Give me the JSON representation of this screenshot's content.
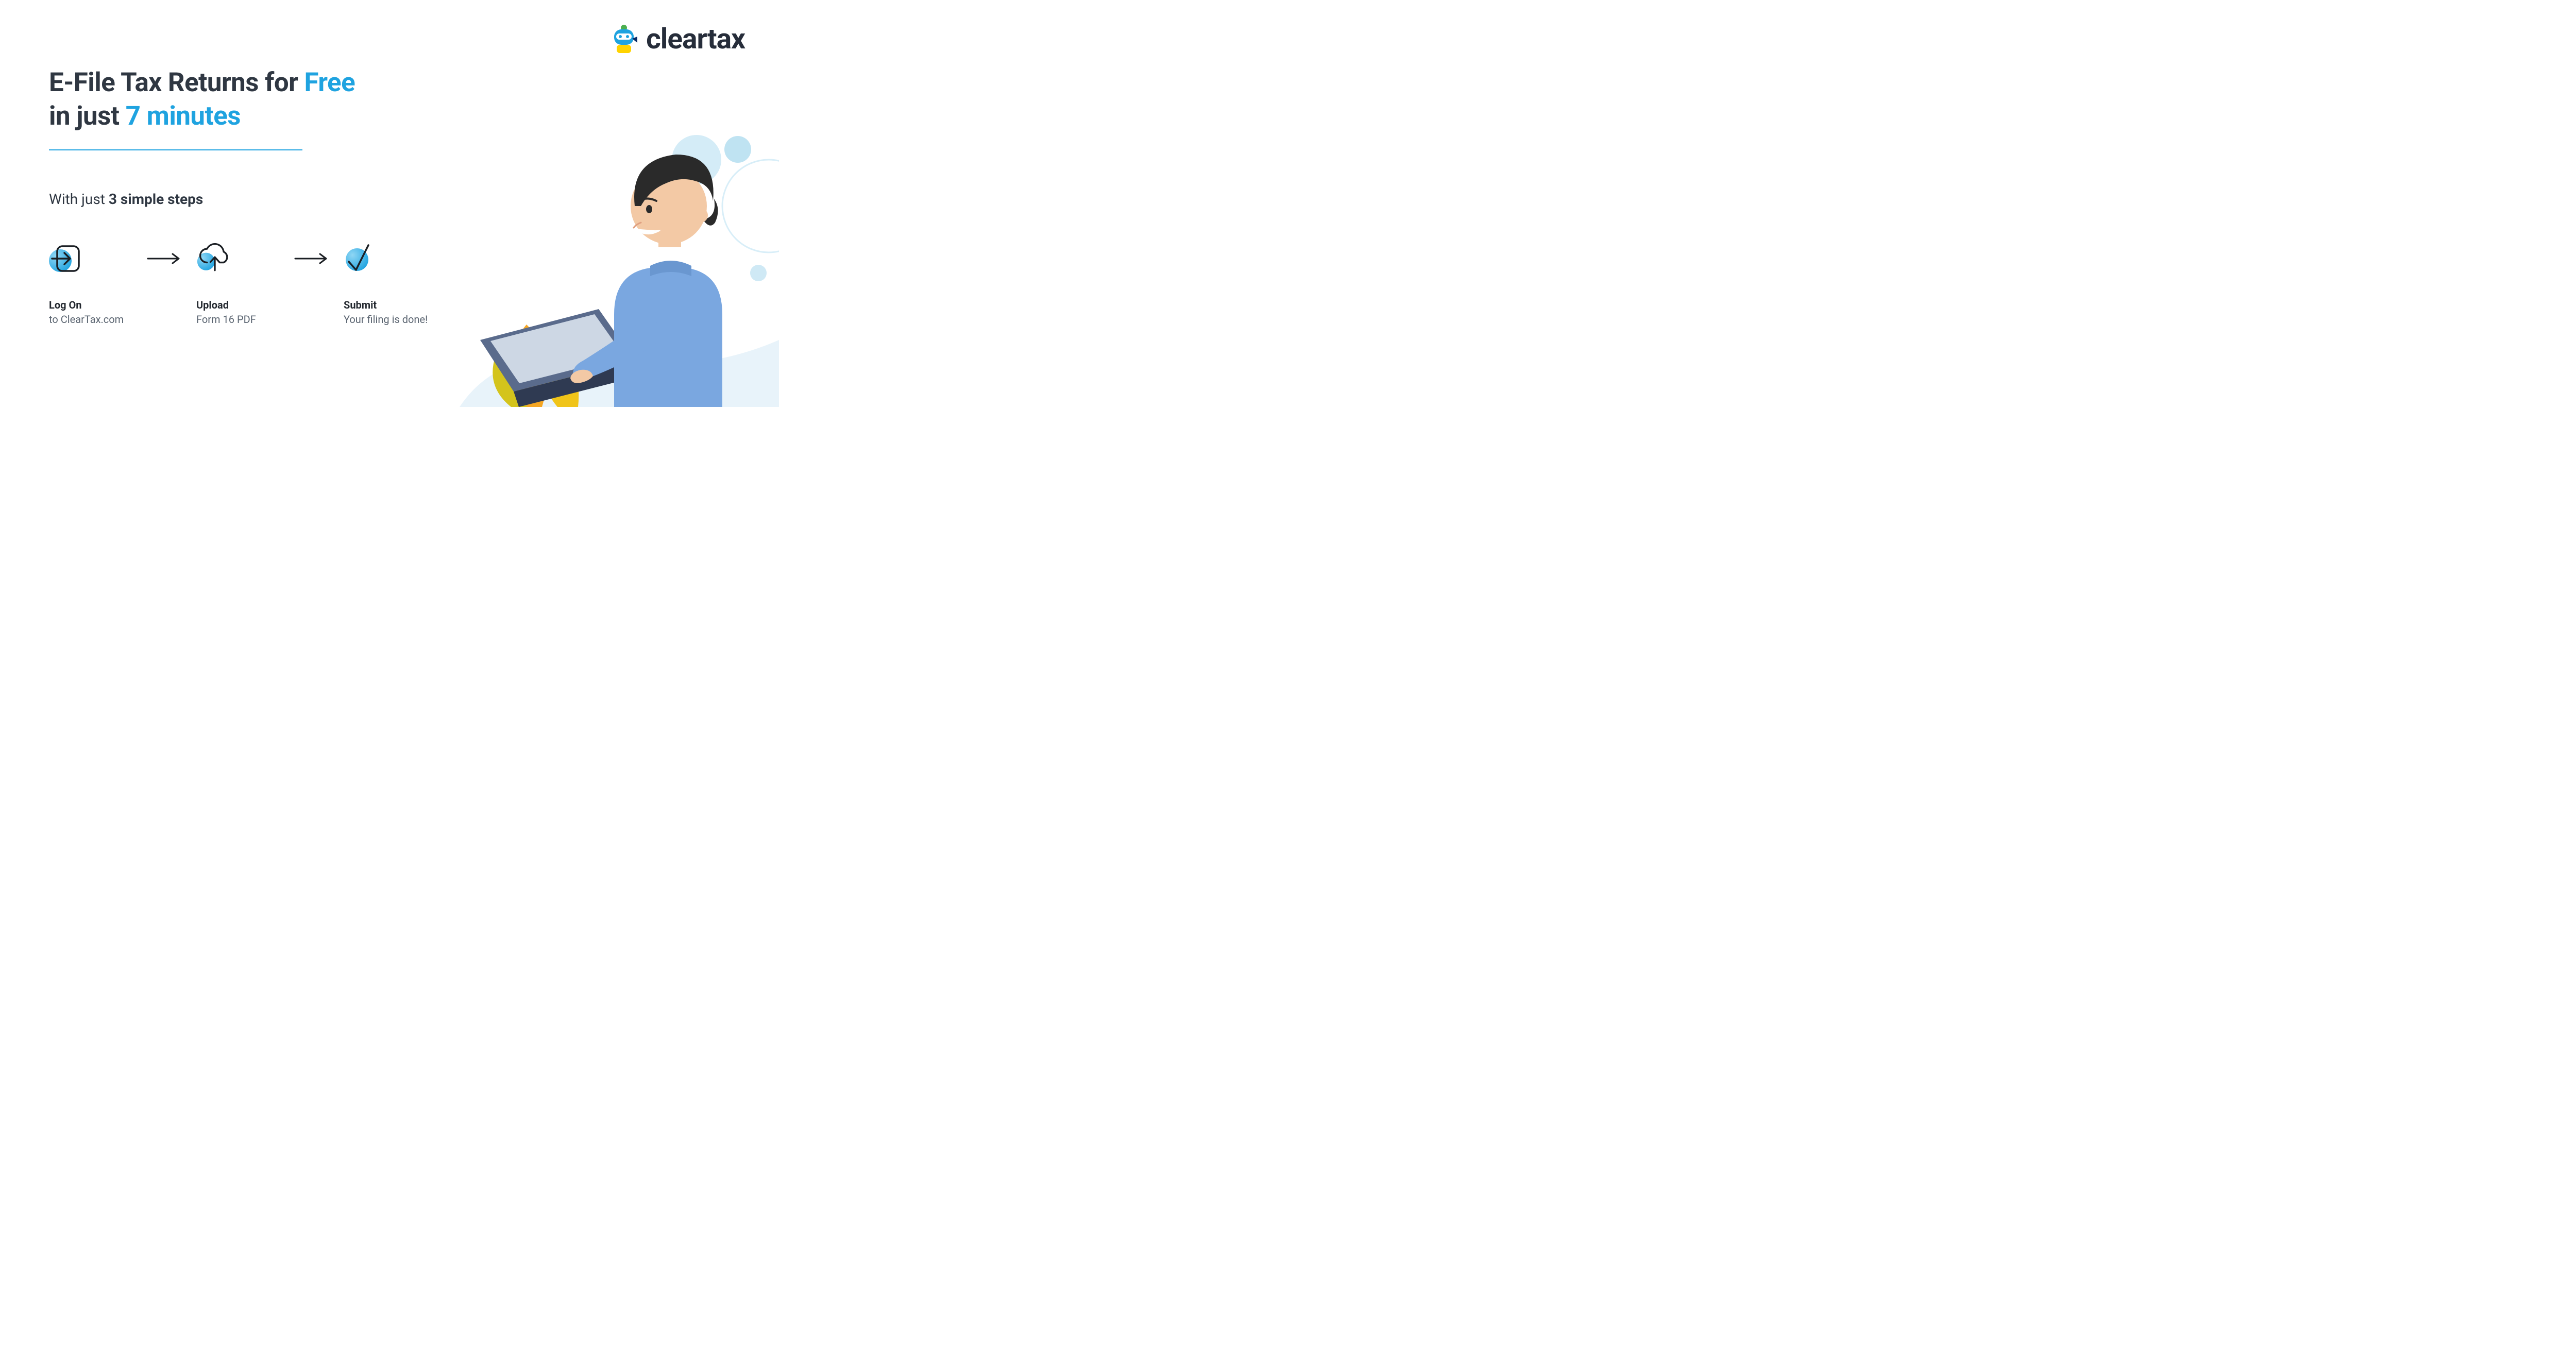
{
  "brand": {
    "name": "cleartax"
  },
  "headline": {
    "part1": "E-File Tax Returns for ",
    "accent1": "Free",
    "part2": "in just ",
    "accent2": "7 minutes"
  },
  "subhead": {
    "prefix": "With just ",
    "bold": "3 simple steps"
  },
  "steps": [
    {
      "icon": "login-icon",
      "title": "Log On",
      "desc": "to ClearTax.com"
    },
    {
      "icon": "upload-icon",
      "title": "Upload",
      "desc": "Form 16 PDF"
    },
    {
      "icon": "check-icon",
      "title": "Submit",
      "desc": "Your filing is done!"
    }
  ],
  "colors": {
    "accent": "#1fa3e0",
    "text": "#2f3742"
  }
}
